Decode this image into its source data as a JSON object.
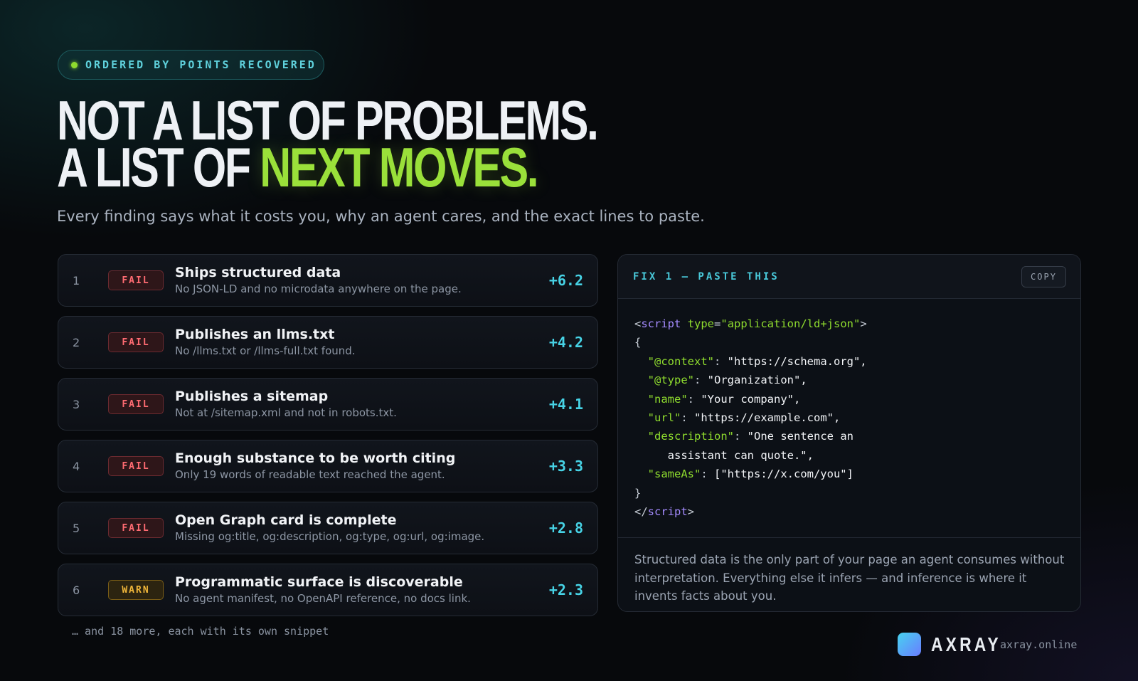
{
  "pill": {
    "label": "ORDERED BY POINTS RECOVERED"
  },
  "headline": {
    "line1": "NOT A LIST OF PROBLEMS.",
    "line2_prefix": "A LIST OF ",
    "line2_accent": "NEXT MOVES."
  },
  "subhead": "Every finding says what it costs you, why an agent cares, and the exact lines to paste.",
  "findings": [
    {
      "num": "1",
      "status": "FAIL",
      "title": "Ships structured data",
      "desc": "No JSON-LD and no microdata anywhere on the page.",
      "points": "+6.2"
    },
    {
      "num": "2",
      "status": "FAIL",
      "title": "Publishes an llms.txt",
      "desc": "No /llms.txt or /llms-full.txt found.",
      "points": "+4.2"
    },
    {
      "num": "3",
      "status": "FAIL",
      "title": "Publishes a sitemap",
      "desc": "Not at /sitemap.xml and not in robots.txt.",
      "points": "+4.1"
    },
    {
      "num": "4",
      "status": "FAIL",
      "title": "Enough substance to be worth citing",
      "desc": "Only 19 words of readable text reached the agent.",
      "points": "+3.3"
    },
    {
      "num": "5",
      "status": "FAIL",
      "title": "Open Graph card is complete",
      "desc": "Missing og:title, og:description, og:type, og:url, og:image.",
      "points": "+2.8"
    },
    {
      "num": "6",
      "status": "WARN",
      "title": "Programmatic surface is discoverable",
      "desc": "No agent manifest, no OpenAPI reference, no docs link.",
      "points": "+2.3"
    }
  ],
  "more": "… and 18 more, each with its own snippet",
  "fix_panel": {
    "title": "FIX 1 — PASTE THIS",
    "copy_label": "COPY",
    "code": {
      "open_lt": "<",
      "open_tag": "script",
      "attr_name": "type",
      "attr_eq": "=",
      "attr_value": "\"application/ld+json\"",
      "open_gt": ">",
      "brace_open": "{",
      "pairs": [
        {
          "key": "\"@context\"",
          "value": "\"https://schema.org\","
        },
        {
          "key": "\"@type\"",
          "value": "\"Organization\","
        },
        {
          "key": "\"name\"",
          "value": "\"Your company\","
        },
        {
          "key": "\"url\"",
          "value": "\"https://example.com\","
        },
        {
          "key": "\"description\"",
          "value": "\"One sentence an"
        },
        {
          "key": "",
          "value": "assistant can quote.\","
        },
        {
          "key": "\"sameAs\"",
          "value": "[\"https://x.com/you\"]"
        }
      ],
      "brace_close": "}",
      "close_lt": "</",
      "close_tag": "script",
      "close_gt": ">"
    },
    "note": "Structured data is the only part of your page an agent consumes without interpretation. Everything else it infers — and inference is where it invents facts about you."
  },
  "brand": {
    "name": "AXRAY",
    "url": "axray.online"
  },
  "colors": {
    "accent_green": "#9ae03a",
    "accent_cyan": "#47d3e6",
    "fail_red": "#ff6b72",
    "warn_amber": "#f1b73a",
    "background": "#07090c"
  }
}
